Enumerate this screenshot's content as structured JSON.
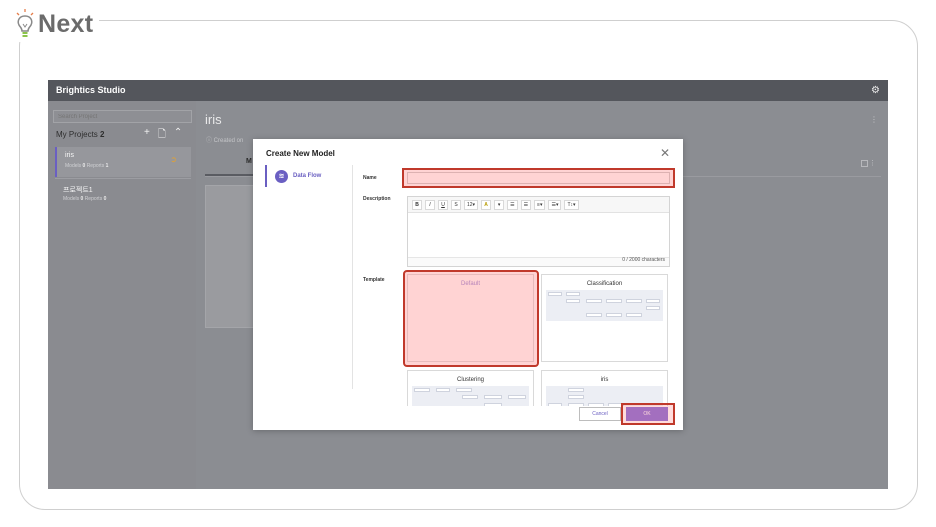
{
  "brand": {
    "text": "Next"
  },
  "app": {
    "title": "Brightics Studio"
  },
  "sidebar": {
    "search_placeholder": "Search Project",
    "my_projects_label": "My Projects",
    "my_projects_count": "2",
    "projects": [
      {
        "name": "iris",
        "models_label": "Models",
        "models": "0",
        "reports_label": "Reports",
        "reports": "1"
      },
      {
        "name": "프로젝트1",
        "models_label": "Models",
        "models": "0",
        "reports_label": "Reports",
        "reports": "0"
      }
    ]
  },
  "content": {
    "title": "iris",
    "info": "Created on",
    "tab": "M"
  },
  "modal": {
    "title": "Create New Model",
    "nav_item": "Data Flow",
    "name_label": "Name",
    "name_value": "",
    "description_label": "Description",
    "toolbar": [
      "B",
      "I",
      "U",
      "S",
      "12▾",
      "A",
      "▾",
      "☰",
      "☰",
      "≡▾",
      "☰▾",
      "T↕▾"
    ],
    "char_count": "0 / 2000 characters",
    "template_label": "Template",
    "templates": [
      "Default",
      "Classification",
      "Clustering",
      "iris"
    ],
    "cancel": "Cancel",
    "ok": "OK"
  },
  "colors": {
    "accent": "#6a5fc2",
    "highlight": "#c0392b",
    "header": "#54565c"
  }
}
